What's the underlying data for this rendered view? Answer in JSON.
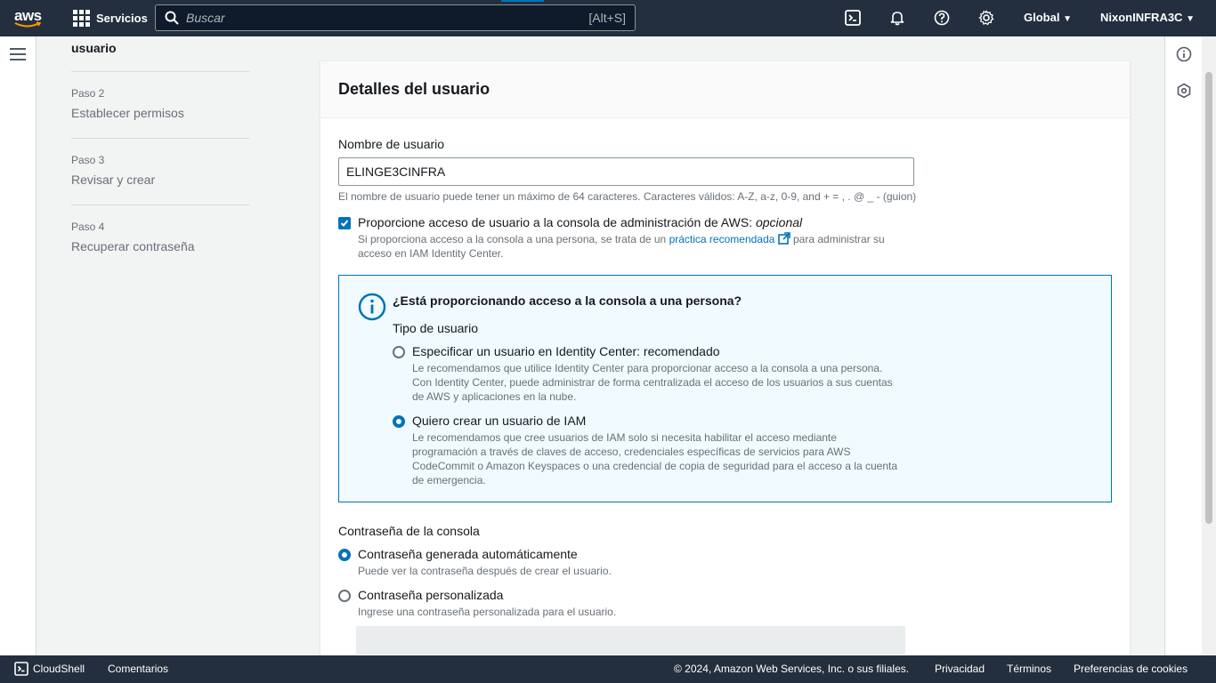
{
  "topnav": {
    "logo_text": "aws",
    "services_label": "Servicios",
    "search_placeholder": "Buscar",
    "search_shortcut": "[Alt+S]",
    "region": "Global",
    "account": "NixonINFRA3C"
  },
  "steps": {
    "partial_label": "usuario",
    "items": [
      {
        "num": "Paso 2",
        "label": "Establecer permisos"
      },
      {
        "num": "Paso 3",
        "label": "Revisar y crear"
      },
      {
        "num": "Paso 4",
        "label": "Recuperar contraseña"
      }
    ]
  },
  "card": {
    "title": "Detalles del usuario",
    "username_label": "Nombre de usuario",
    "username_value": "ELINGE3CINFRA",
    "username_hint": "El nombre de usuario puede tener un máximo de 64 caracteres. Caracteres válidos: A-Z, a-z, 0-9, and + = , . @ _ - (guion)",
    "console_access": {
      "label": "Proporcione acceso de usuario a la consola de administración de AWS:",
      "optional": "opcional",
      "desc_before": "Si proporciona acceso a la consola a una persona, se trata de un",
      "link": "práctica recomendada",
      "desc_after": "para administrar su acceso en IAM Identity Center.",
      "checked": true
    },
    "infobox": {
      "title": "¿Está proporcionando acceso a la consola a una persona?",
      "user_type_label": "Tipo de usuario",
      "options": [
        {
          "label": "Especificar un usuario en Identity Center: recomendado",
          "desc": "Le recomendamos que utilice Identity Center para proporcionar acceso a la consola a una persona. Con Identity Center, puede administrar de forma centralizada el acceso de los usuarios a sus cuentas de AWS y aplicaciones en la nube.",
          "selected": false
        },
        {
          "label": "Quiero crear un usuario de IAM",
          "desc": "Le recomendamos que cree usuarios de IAM solo si necesita habilitar el acceso mediante programación a través de claves de acceso, credenciales específicas de servicios para AWS CodeCommit o Amazon Keyspaces o una credencial de copia de seguridad para el acceso a la cuenta de emergencia.",
          "selected": true
        }
      ]
    },
    "password": {
      "label": "Contraseña de la consola",
      "options": [
        {
          "label": "Contraseña generada automáticamente",
          "desc": "Puede ver la contraseña después de crear el usuario.",
          "selected": true
        },
        {
          "label": "Contraseña personalizada",
          "desc": "Ingrese una contraseña personalizada para el usuario.",
          "selected": false
        }
      ]
    }
  },
  "footer": {
    "cloudshell": "CloudShell",
    "feedback": "Comentarios",
    "copyright": "© 2024, Amazon Web Services, Inc. o sus filiales.",
    "privacy": "Privacidad",
    "terms": "Términos",
    "cookies": "Preferencias de cookies"
  },
  "colors": {
    "nav_bg": "#232f3e",
    "accent": "#0073bb",
    "info_bg": "#f1faff"
  }
}
